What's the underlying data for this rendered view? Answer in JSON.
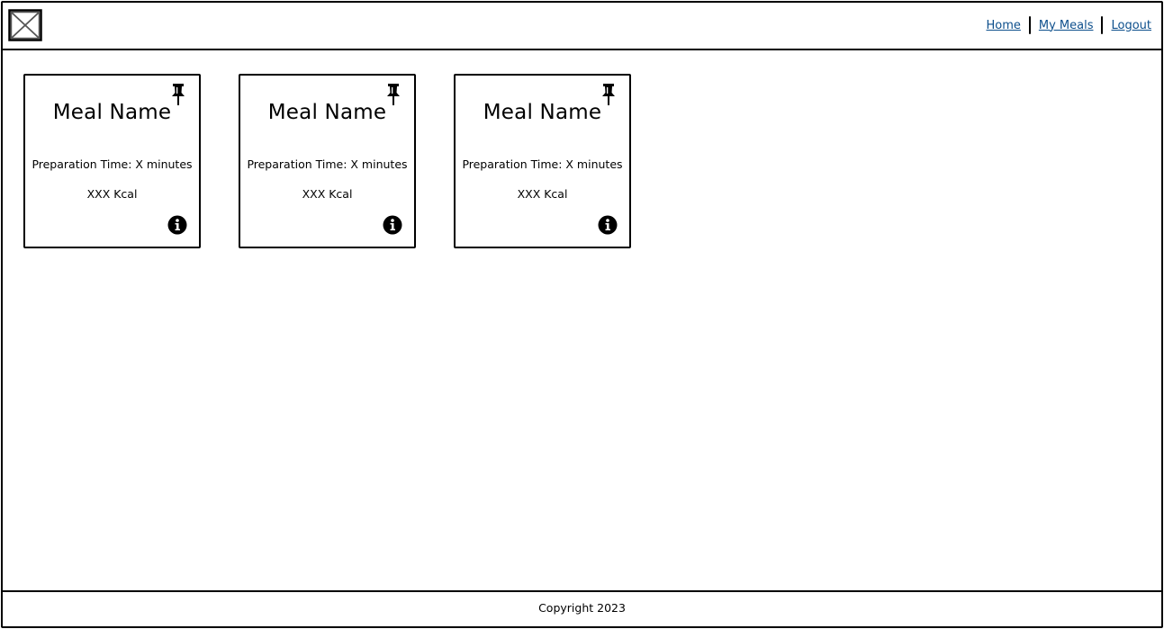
{
  "header": {
    "logo_icon": "image-placeholder-icon",
    "nav": {
      "home": "Home",
      "my_meals": "My Meals",
      "logout": "Logout"
    }
  },
  "meals": [
    {
      "name": "Meal Name",
      "prep_time": "Preparation Time: X minutes",
      "kcal": "XXX Kcal",
      "pin_icon": "pushpin-icon",
      "info_icon": "info-icon"
    },
    {
      "name": "Meal Name",
      "prep_time": "Preparation Time: X minutes",
      "kcal": "XXX Kcal",
      "pin_icon": "pushpin-icon",
      "info_icon": "info-icon"
    },
    {
      "name": "Meal Name",
      "prep_time": "Preparation Time: X minutes",
      "kcal": "XXX Kcal",
      "pin_icon": "pushpin-icon",
      "info_icon": "info-icon"
    }
  ],
  "footer": {
    "copyright": "Copyright 2023"
  },
  "colors": {
    "link": "#0d4f8c",
    "border": "#000000",
    "background": "#ffffff"
  }
}
